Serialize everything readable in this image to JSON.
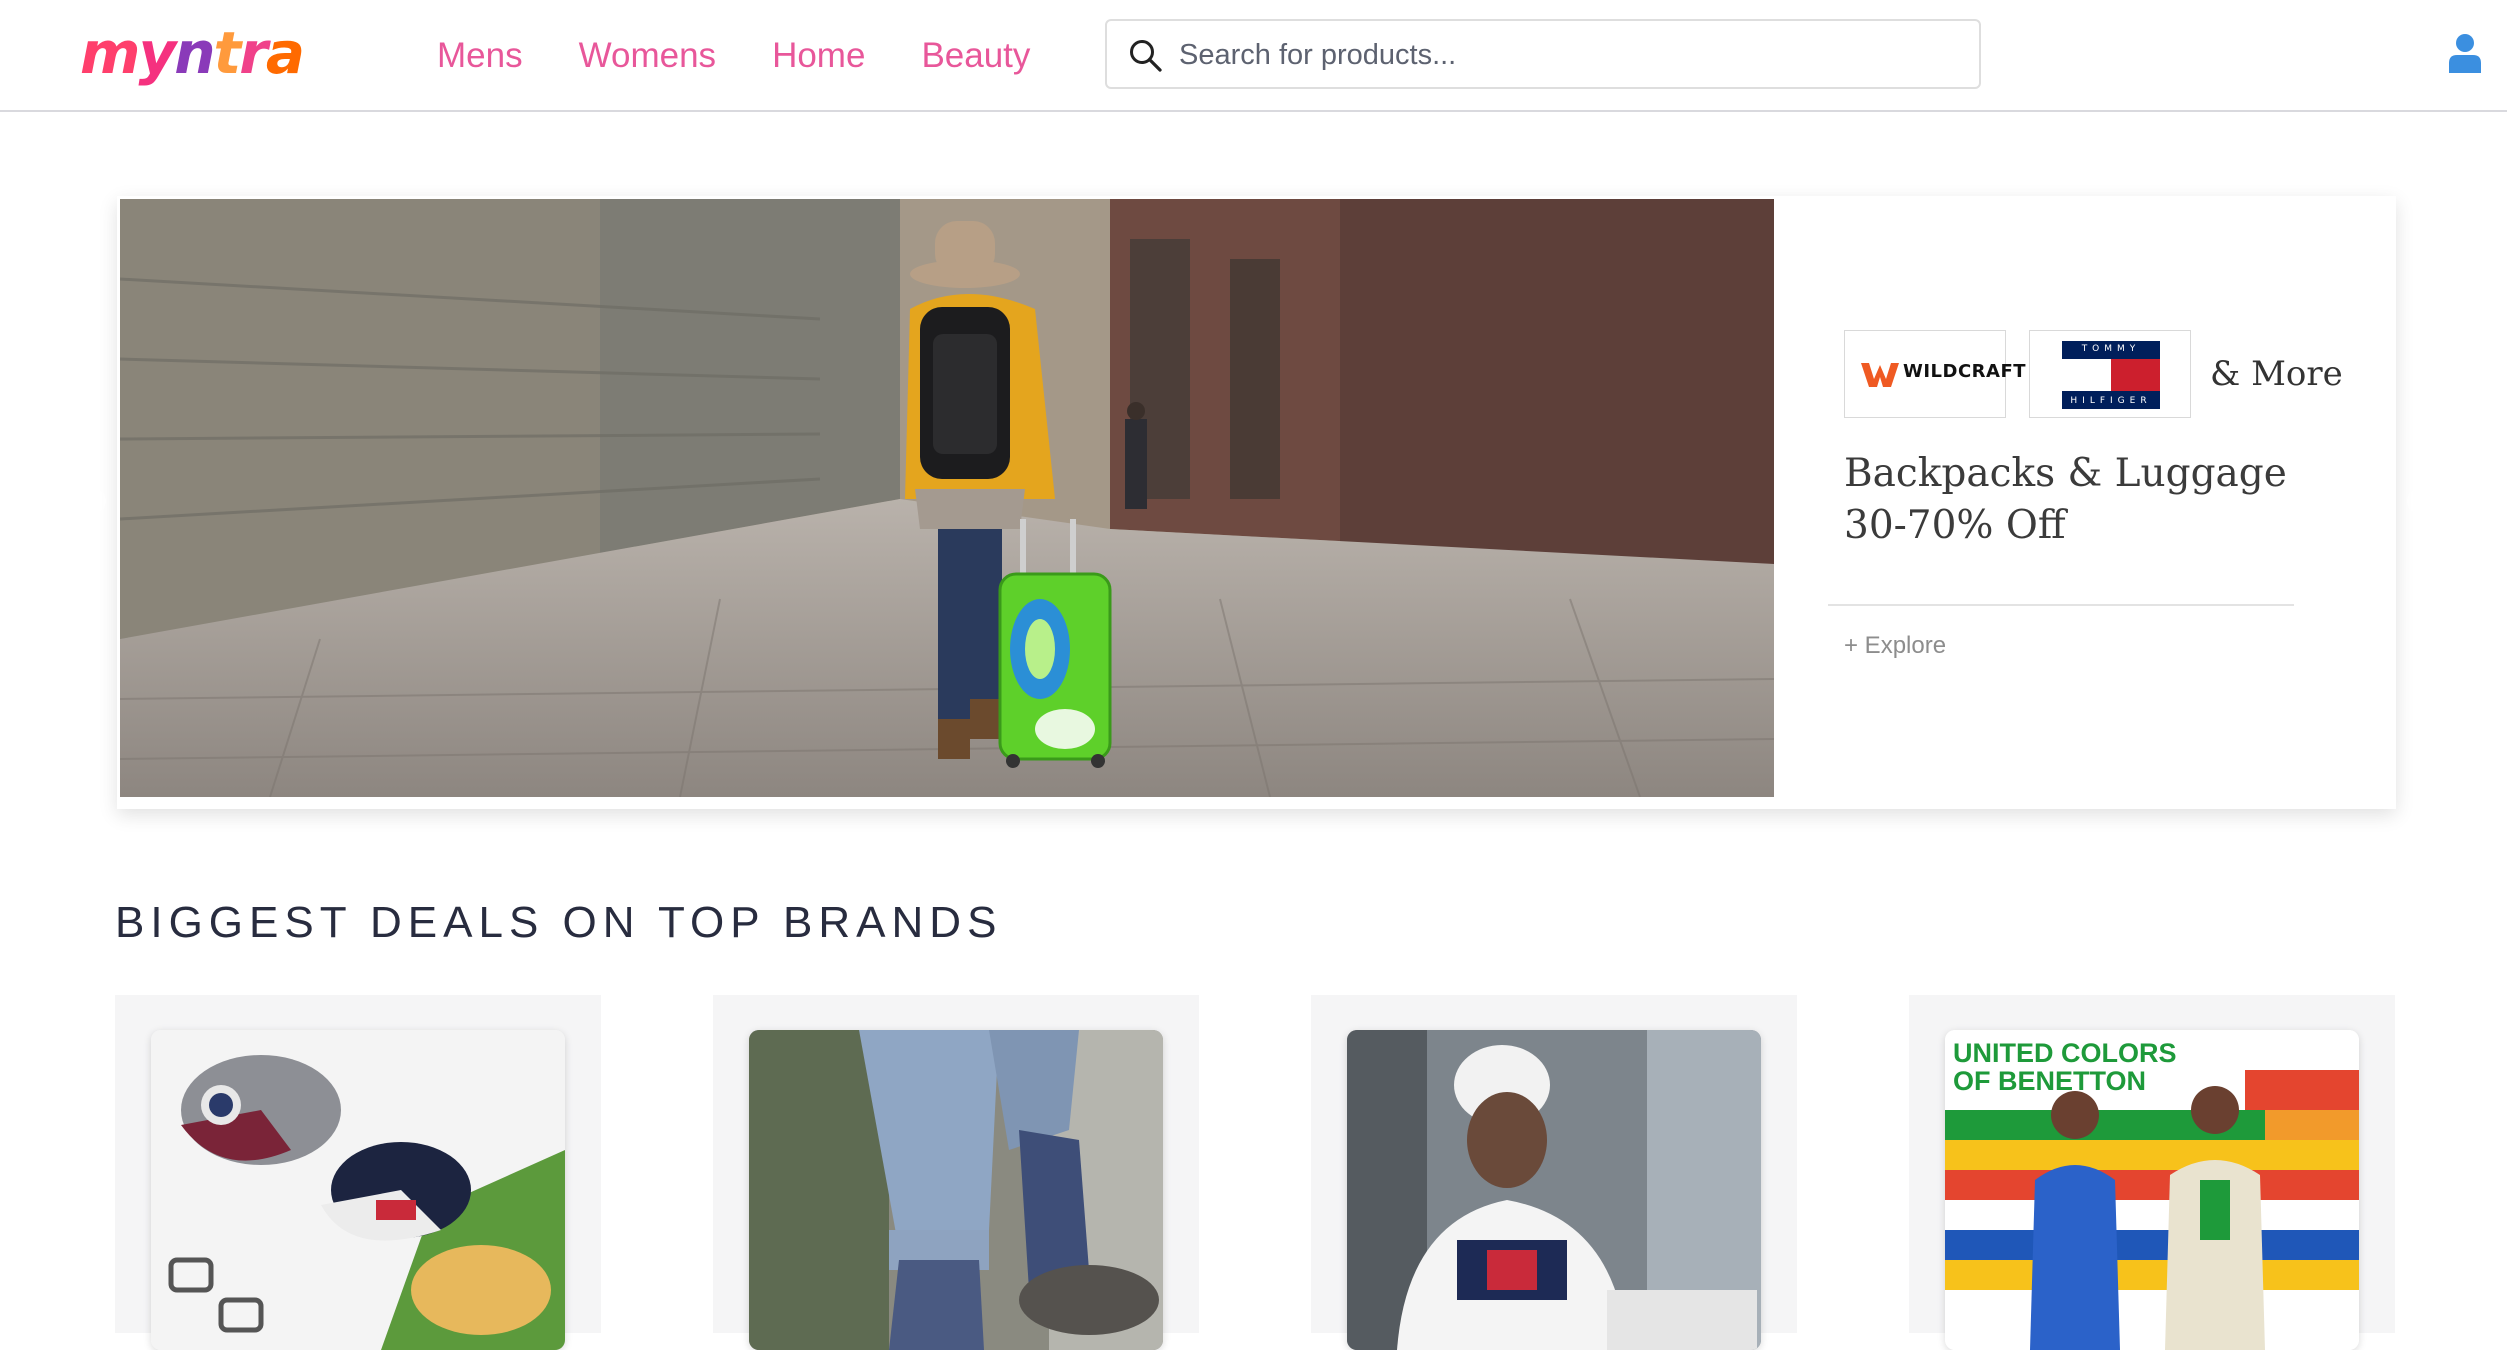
{
  "header": {
    "logo_text": "myntra",
    "nav": [
      {
        "label": "Mens"
      },
      {
        "label": "Womens"
      },
      {
        "label": "Home"
      },
      {
        "label": "Beauty"
      }
    ],
    "search": {
      "placeholder": "Search for products..."
    },
    "colors": {
      "nav_text": "#e8579a",
      "user_icon": "#3b8fe0"
    }
  },
  "banner": {
    "brands": [
      {
        "name": "WILDCRAFT",
        "icon": "wildcraft-logo"
      },
      {
        "name_top": "TOMMY",
        "name_bottom": "HILFIGER",
        "icon": "tommy-hilfiger-flag-logo"
      }
    ],
    "more_text": "& More",
    "title_line1": "Backpacks & Luggage",
    "title_line2": "30-70% Off",
    "explore_label": "+ Explore"
  },
  "deals": {
    "title": "BIGGEST DEALS ON TOP BRANDS",
    "cards": [
      {
        "image": "caps-and-belts-photo"
      },
      {
        "image": "jeans-and-sneakers-photo"
      },
      {
        "image": "man-in-beanie-photo"
      },
      {
        "image": "united-colors-of-benetton-photo",
        "overlay_text": "UNITED COLORS OF BENETTON"
      }
    ]
  }
}
